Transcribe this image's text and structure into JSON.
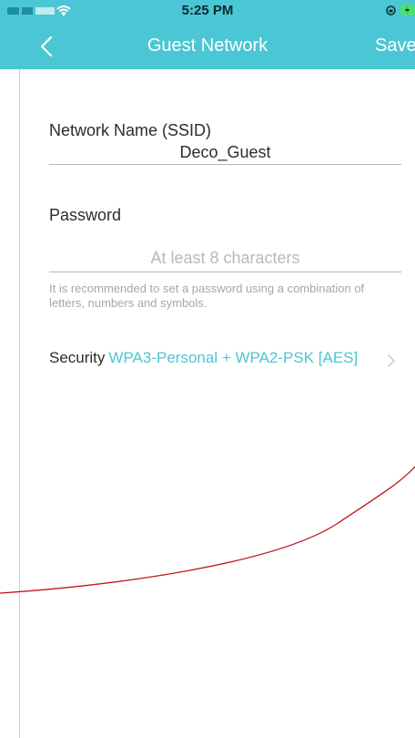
{
  "status_bar": {
    "time": "5:25 PM"
  },
  "nav": {
    "title": "Guest Network",
    "save_label": "Save",
    "back_icon": "chevron-left-icon"
  },
  "network_name": {
    "label": "Network Name (SSID)",
    "value": "Deco_Guest"
  },
  "password": {
    "label": "Password",
    "value": "",
    "placeholder": "At least 8 characters",
    "hint": "It is recommended to set a password using a combination of letters, numbers and symbols."
  },
  "security": {
    "label": "Security",
    "value": "WPA3-Personal + WPA2-PSK [AES]",
    "chevron_icon": "chevron-right-icon"
  },
  "colors": {
    "accent": "#4bc6d4",
    "text": "#2c2c2c",
    "hint": "#a7a7a7",
    "annotation": "#c0161c"
  }
}
